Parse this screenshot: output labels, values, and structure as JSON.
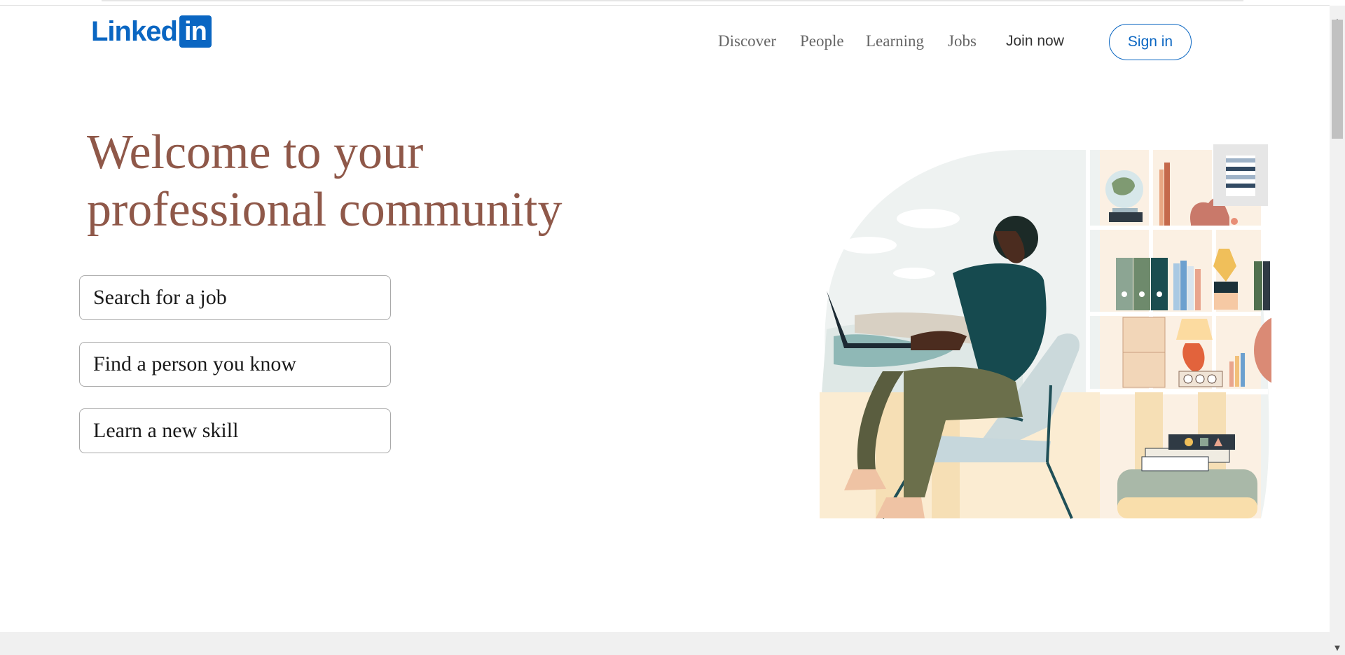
{
  "brand": {
    "logo_text": "Linked",
    "logo_box": "in"
  },
  "nav": {
    "links": [
      {
        "label": "Discover",
        "icon": "compass-icon"
      },
      {
        "label": "People",
        "icon": "people-icon"
      },
      {
        "label": "Learning",
        "icon": "learning-icon"
      },
      {
        "label": "Jobs",
        "icon": "briefcase-icon"
      }
    ],
    "join_label": "Join now",
    "signin_label": "Sign in"
  },
  "hero": {
    "headline_line1": "Welcome to your",
    "headline_line2": "professional community",
    "options": [
      "Search for a job",
      "Find a person you know",
      "Learn a new skill"
    ]
  },
  "colors": {
    "brand_blue": "#0a66c2",
    "headline": "#8f5849",
    "nav_text": "#666666",
    "border": "#a8a8a8"
  },
  "illustration": {
    "subject": "person-working-on-laptop-illustration"
  }
}
